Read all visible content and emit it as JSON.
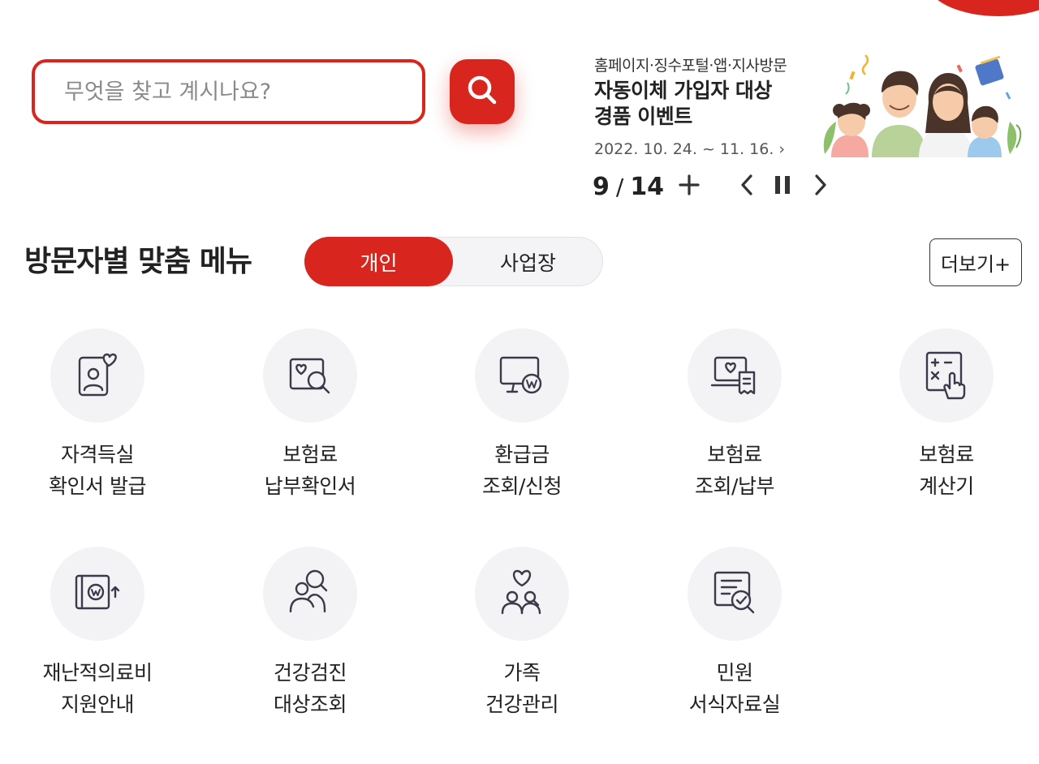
{
  "search": {
    "placeholder": "무엇을 찾고 계시나요?",
    "button_icon": "search-icon"
  },
  "banner": {
    "subtitle": "홈페이지·징수포털·앱·지사방문",
    "title_line1": "자동이체 가입자 대상",
    "title_line2": "경품 이벤트",
    "date": "2022. 10. 24. ~ 11. 16.",
    "date_chevron": "›",
    "illustration": "family-illustration"
  },
  "slider": {
    "current": "9",
    "separator": "/",
    "total": "14",
    "icons": [
      "plus-icon",
      "chevron-left-icon",
      "pause-icon",
      "chevron-right-icon"
    ]
  },
  "section": {
    "title": "방문자별 맞춤 메뉴",
    "toggle": [
      "개인",
      "사업장"
    ],
    "active_toggle": "개인",
    "more_label": "더보기+"
  },
  "menu": [
    {
      "line1": "자격득실",
      "line2": "확인서 발급",
      "icon": "certificate-heart-icon"
    },
    {
      "line1": "보험료",
      "line2": "납부확인서",
      "icon": "search-heart-document-icon"
    },
    {
      "line1": "환급금",
      "line2": "조회/신청",
      "icon": "monitor-won-icon"
    },
    {
      "line1": "보험료",
      "line2": "조회/납부",
      "icon": "laptop-receipt-icon"
    },
    {
      "line1": "보험료",
      "line2": "계산기",
      "icon": "calculator-touch-icon"
    },
    {
      "line1": "재난적의료비",
      "line2": "지원안내",
      "icon": "book-won-icon"
    },
    {
      "line1": "건강검진",
      "line2": "대상조회",
      "icon": "people-search-icon"
    },
    {
      "line1": "가족",
      "line2": "건강관리",
      "icon": "family-heart-icon"
    },
    {
      "line1": "민원",
      "line2": "서식자료실",
      "icon": "document-check-icon"
    }
  ],
  "colors": {
    "accent": "#d8261e",
    "circle_bg": "#f3f3f5",
    "text": "#222222"
  }
}
